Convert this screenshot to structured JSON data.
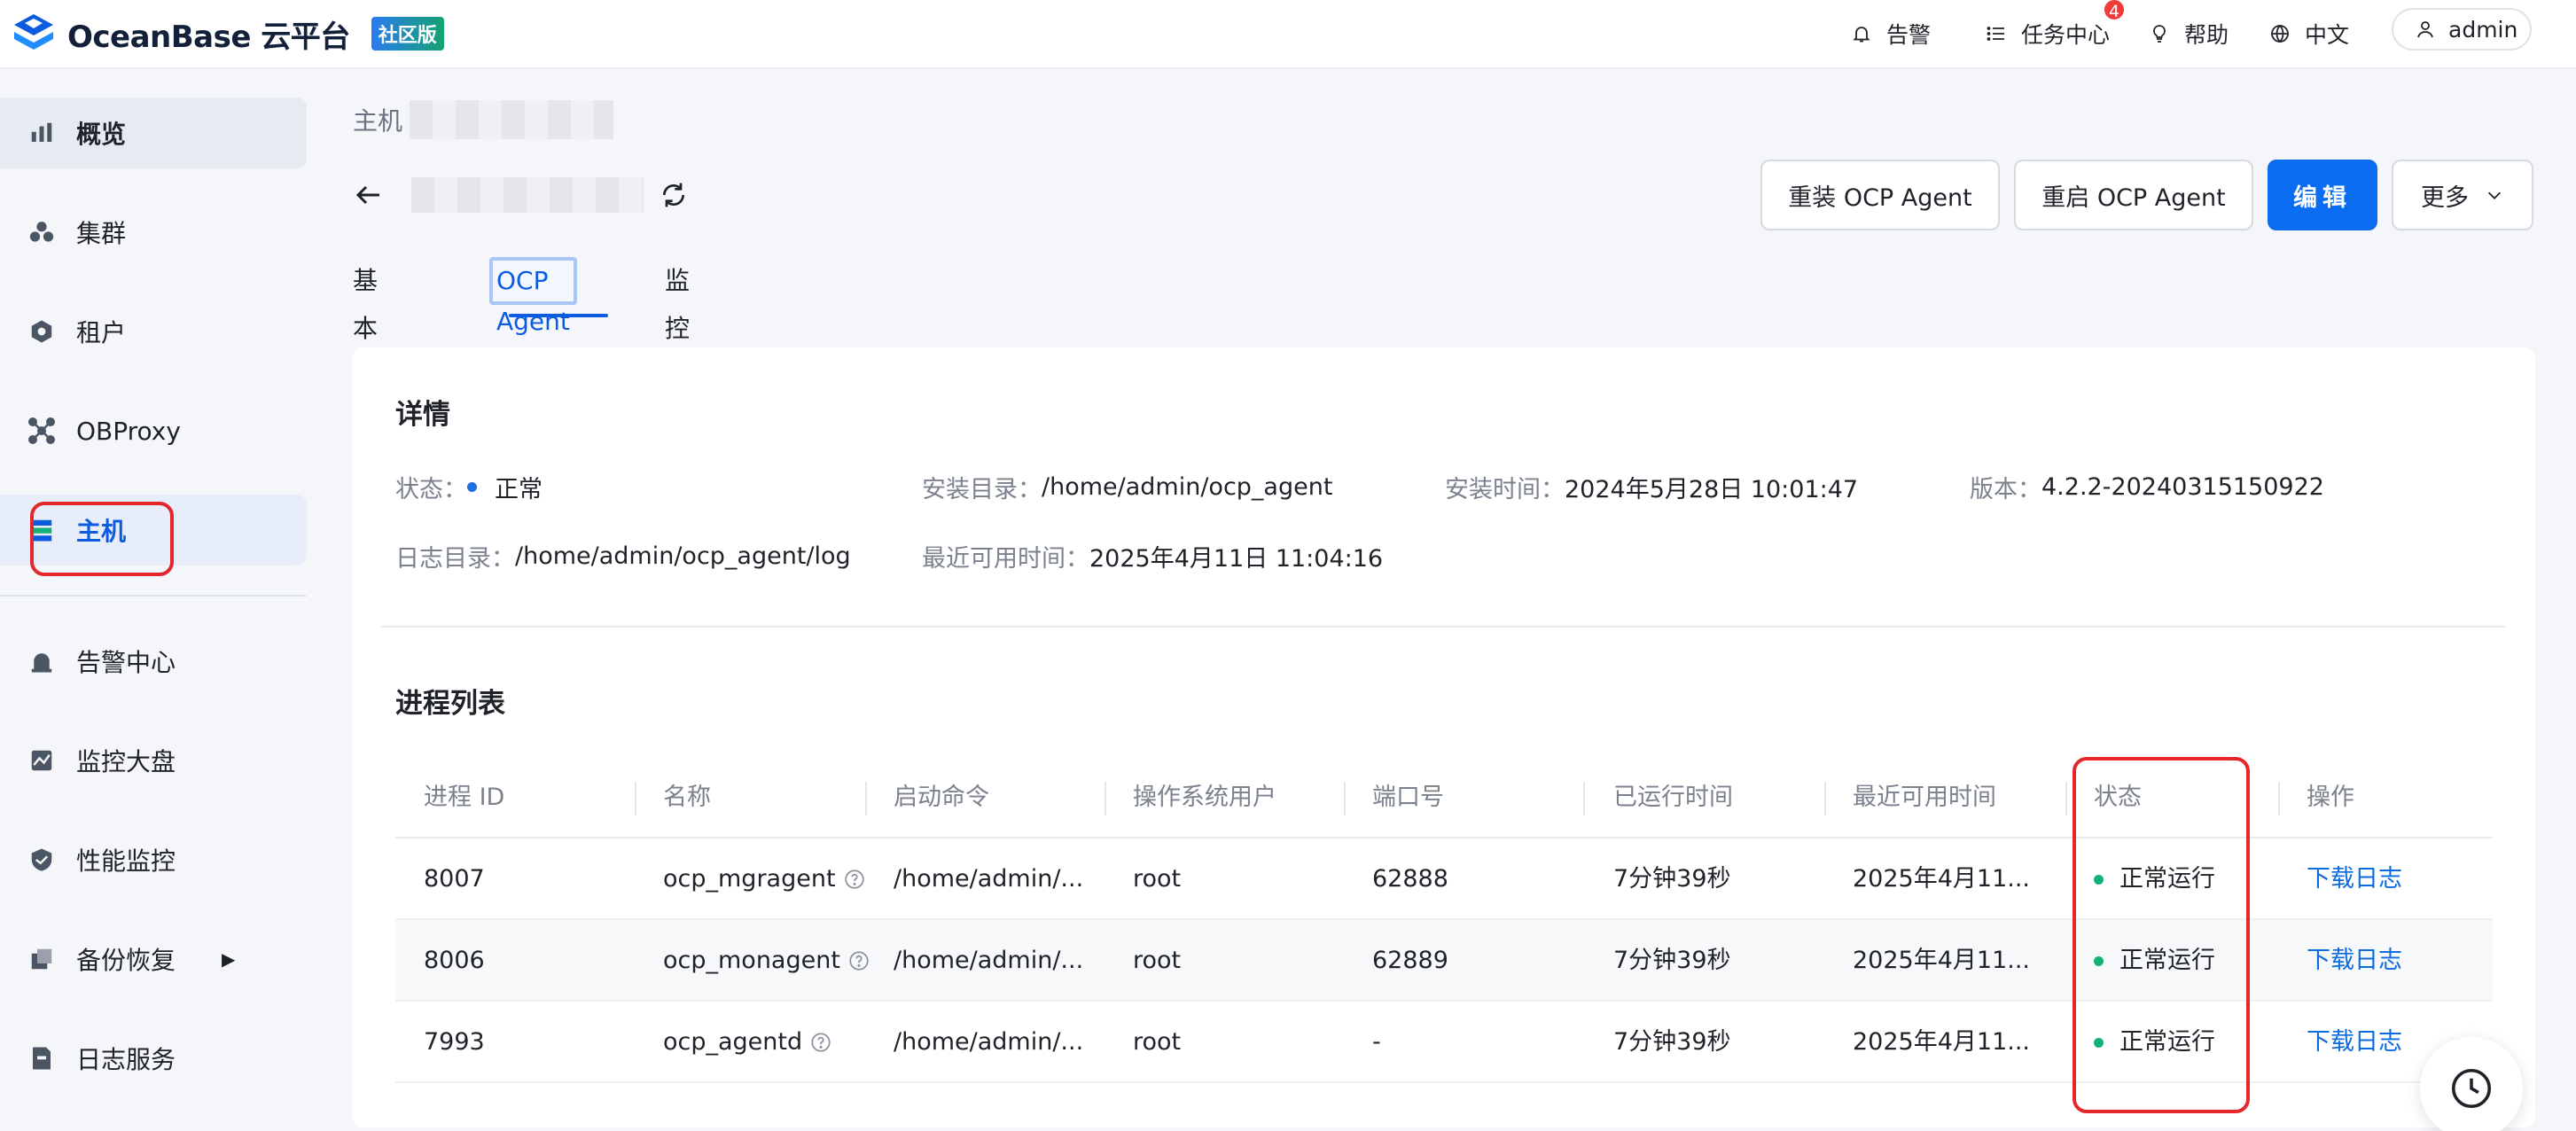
{
  "header": {
    "logo_text": "OceanBase 云平台",
    "edition": "社区版",
    "alerts": "告警",
    "tasks": "任务中心",
    "tasks_badge": "4",
    "help": "帮助",
    "language": "中文",
    "user": "admin"
  },
  "sidebar": {
    "items": [
      {
        "label": "概览"
      },
      {
        "label": "集群"
      },
      {
        "label": "租户"
      },
      {
        "label": "OBProxy"
      },
      {
        "label": "主机"
      },
      {
        "label": "告警中心"
      },
      {
        "label": "监控大盘"
      },
      {
        "label": "性能监控"
      },
      {
        "label": "备份恢复"
      },
      {
        "label": "日志服务"
      }
    ]
  },
  "breadcrumb": {
    "root": "主机"
  },
  "actions": {
    "reinstall": "重装 OCP Agent",
    "restart": "重启 OCP Agent",
    "edit": "编辑",
    "more": "更多"
  },
  "tabs": [
    "基本信息",
    "OCP Agent",
    "监控"
  ],
  "details": {
    "title": "详情",
    "status_label": "状态：",
    "status_value": "正常",
    "install_dir_label": "安装目录：",
    "install_dir_value": "/home/admin/ocp_agent",
    "install_time_label": "安装时间：",
    "install_time_value": "2024年5月28日 10:01:47",
    "version_label": "版本：",
    "version_value": "4.2.2-20240315150922",
    "log_dir_label": "日志目录：",
    "log_dir_value": "/home/admin/ocp_agent/log",
    "last_available_label": "最近可用时间：",
    "last_available_value": "2025年4月11日 11:04:16"
  },
  "process_list": {
    "title": "进程列表",
    "columns": [
      "进程 ID",
      "名称",
      "启动命令",
      "操作系统用户",
      "端口号",
      "已运行时间",
      "最近可用时间",
      "状态",
      "操作"
    ],
    "rows": [
      {
        "pid": "8007",
        "name": "ocp_mgragent",
        "cmd": "/home/admin/...",
        "user": "root",
        "port": "62888",
        "uptime": "7分钟39秒",
        "last": "2025年4月11...",
        "status": "正常运行",
        "action": "下载日志"
      },
      {
        "pid": "8006",
        "name": "ocp_monagent",
        "cmd": "/home/admin/...",
        "user": "root",
        "port": "62889",
        "uptime": "7分钟39秒",
        "last": "2025年4月11...",
        "status": "正常运行",
        "action": "下载日志"
      },
      {
        "pid": "7993",
        "name": "ocp_agentd",
        "cmd": "/home/admin/...",
        "user": "root",
        "port": "-",
        "uptime": "7分钟39秒",
        "last": "2025年4月11...",
        "status": "正常运行",
        "action": "下载日志"
      }
    ]
  },
  "colors": {
    "accent": "#0a6cf0",
    "success": "#13b176",
    "highlight": "#e5262b"
  }
}
